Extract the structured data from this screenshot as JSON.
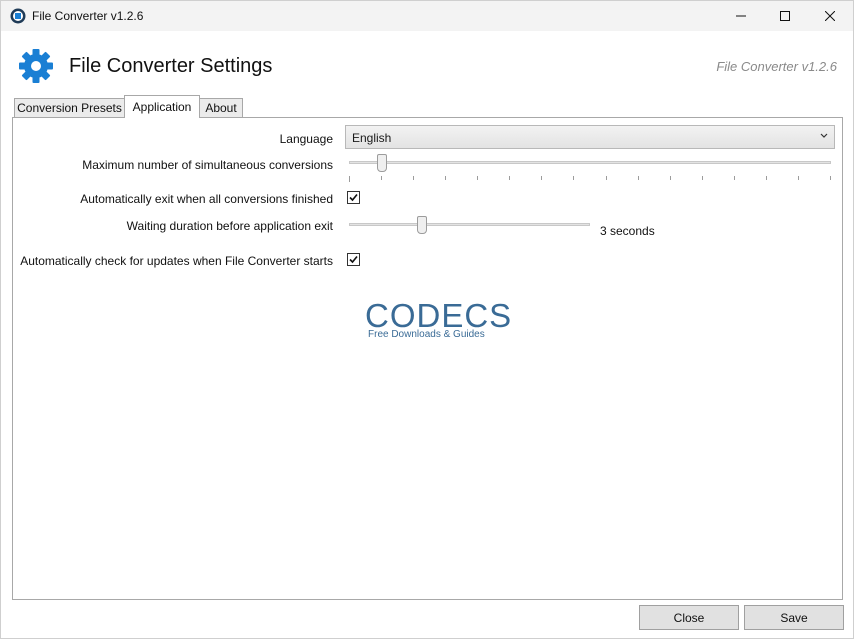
{
  "window": {
    "title": "File Converter v1.2.6",
    "icon": "file-converter-app-icon",
    "controls": [
      "minimize-icon",
      "maximize-icon",
      "close-icon"
    ]
  },
  "header": {
    "title": "File Converter Settings",
    "version": "File Converter v1.2.6",
    "icon": "gear-icon",
    "accent_color": "#1a7fd4"
  },
  "tabs": [
    {
      "label": "Conversion Presets",
      "selected": false
    },
    {
      "label": "Application",
      "selected": true
    },
    {
      "label": "About",
      "selected": false
    }
  ],
  "settings": {
    "language": {
      "label": "Language",
      "value": "English"
    },
    "max_conversions": {
      "label": "Maximum number of simultaneous conversions",
      "value": 2,
      "min": 1,
      "max": 16
    },
    "auto_exit": {
      "label": "Automatically exit when all conversions finished",
      "checked": true
    },
    "waiting_duration": {
      "label": "Waiting duration before application exit",
      "value_text": "3 seconds",
      "fraction": 0.3
    },
    "check_updates": {
      "label": "Automatically check for updates when File Converter starts",
      "checked": true
    }
  },
  "watermark": {
    "title": "CODECS",
    "subtitle": "Free Downloads & Guides",
    "color": "#3a6b96"
  },
  "footer": {
    "close_label": "Close",
    "save_label": "Save"
  }
}
